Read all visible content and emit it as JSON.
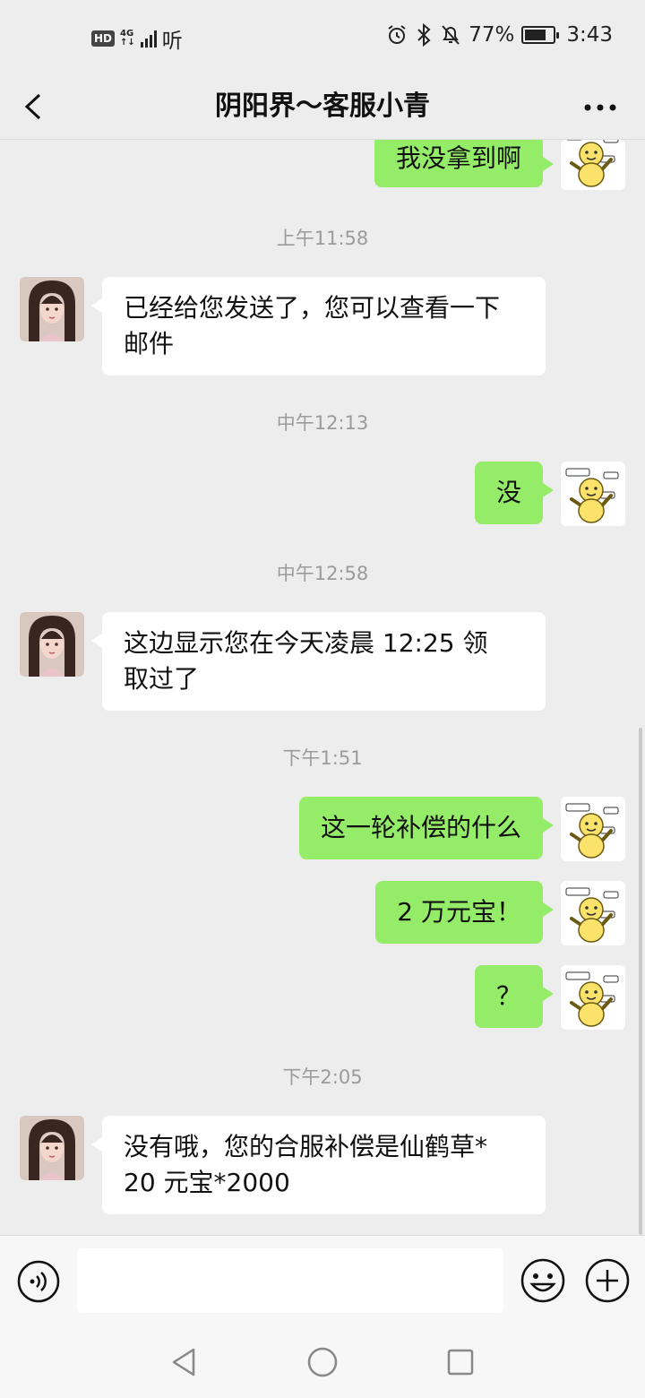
{
  "status_bar": {
    "hd": "HD",
    "network_type_top": "4G",
    "network_type_bottom": "↑↓",
    "carrier_text": "听",
    "battery_percent": "77%",
    "battery_level": 0.77,
    "time": "3:43"
  },
  "header": {
    "title": "阴阳界～客服小青"
  },
  "timestamps": {
    "t1": "上午11:58",
    "t2": "中午12:13",
    "t3": "中午12:58",
    "t4": "下午1:51",
    "t5": "下午2:05"
  },
  "messages": {
    "m0": "我没拿到啊",
    "m1_line1": "已经给您发送了，您可以查看一下",
    "m1_line2": "邮件",
    "m2": "没",
    "m3_line1": "这边显示您在今天凌晨 12:25 领",
    "m3_line2": "取过了",
    "m4": "这一轮补偿的什么",
    "m5": "2 万元宝！",
    "m6": "？",
    "m7_line1": "没有哦，您的合服补偿是仙鹤草*",
    "m7_line2": "20 元宝*2000"
  },
  "input": {
    "value": "",
    "placeholder": ""
  },
  "colors": {
    "outgoing_bubble": "#95ec69",
    "incoming_bubble": "#ffffff",
    "background": "#ededed"
  },
  "icons": {
    "back": "chevron-left-icon",
    "more": "more-dots-icon",
    "voice": "voice-icon",
    "emoji": "emoji-icon",
    "plus": "plus-icon"
  }
}
